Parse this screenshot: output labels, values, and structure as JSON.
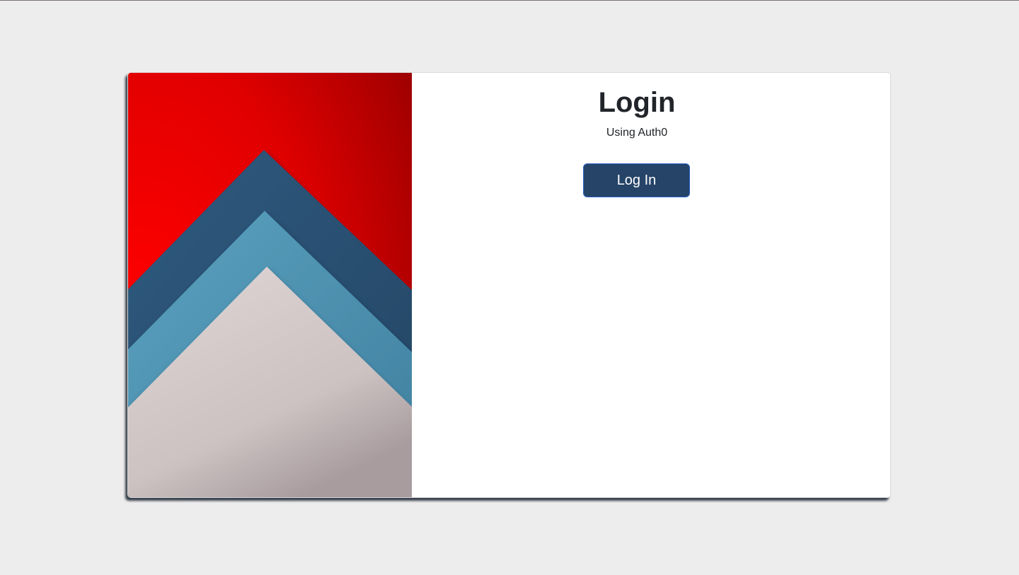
{
  "login": {
    "title": "Login",
    "subtitle": "Using Auth0",
    "button_label": "Log In"
  },
  "colors": {
    "page_background": "#eeeded",
    "card_background": "#ffffff",
    "button_background": "#254468",
    "button_border": "#2f62c9",
    "button_text": "#ffffff",
    "hero_red": "#e60000",
    "hero_dark_blue": "#2c5478",
    "hero_light_blue": "#5096b4",
    "hero_pale": "#d6cccc"
  }
}
